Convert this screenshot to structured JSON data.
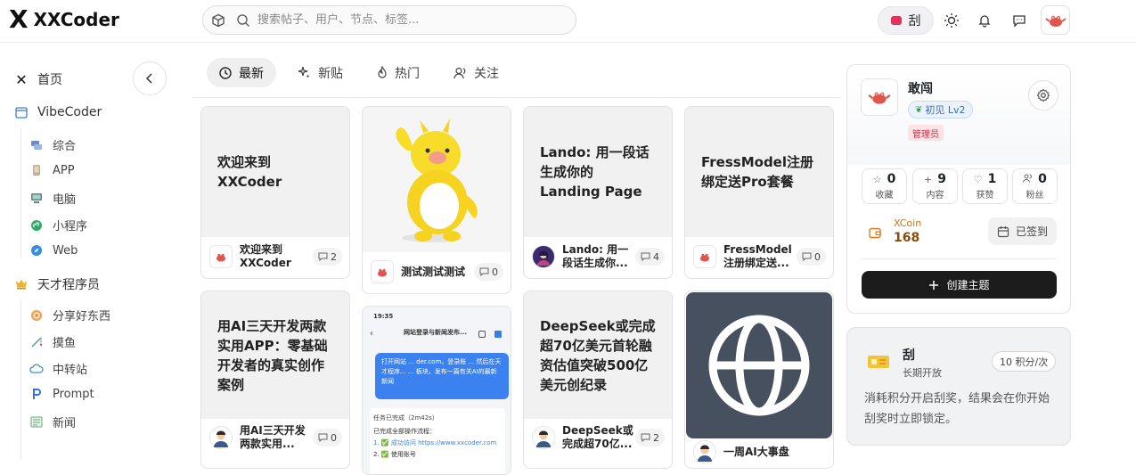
{
  "brand": {
    "logo_mark": "X",
    "name": "XXCoder"
  },
  "search": {
    "placeholder": "搜索帖子、用户、节点、标签..."
  },
  "topbar": {
    "scratch_label": "刮"
  },
  "sidebar": {
    "home": "首页",
    "vibecoder": "VibeCoder",
    "vibe_items": [
      "综合",
      "APP",
      "电脑",
      "小程序",
      "Web"
    ],
    "genius": "天才程序员",
    "genius_items": [
      "分享好东西",
      "摸鱼",
      "中转站",
      "Prompt",
      "新闻"
    ]
  },
  "tabs": [
    "最新",
    "新贴",
    "热门",
    "关注"
  ],
  "cards": [
    {
      "cover_title": "欢迎来到XXCoder",
      "title": "欢迎来到XXCoder",
      "count": "2"
    },
    {
      "cover_title": "",
      "title": "测试测试测试",
      "count": "0"
    },
    {
      "cover_title": "Lando: 用一段话生成你的 Landing Page",
      "title": "Lando: 用一段话生成你...",
      "count": "4"
    },
    {
      "cover_title": "FressModel注册绑定送Pro套餐",
      "title": "FressModel注册绑定送...",
      "count": "0"
    },
    {
      "cover_title": "用AI三天开发两款实用APP：零基础开发者的真实创作案例",
      "title": "用AI三天开发两款实用...",
      "count": "0"
    },
    {
      "cover_title": "",
      "title": "",
      "count": ""
    },
    {
      "cover_title": "DeepSeek或完成超70亿美元首轮融资估值突破500亿美元创纪录",
      "title": "DeepSeek或完成超70亿...",
      "count": "2"
    },
    {
      "cover_title": "",
      "title": "一周AI大事盘",
      "count": ""
    }
  ],
  "phone_shot": {
    "time": "19:35",
    "header": "网站登录与新闻发布...",
    "bubble": "打开网站 ... der.com，登录账 ... 然后在天才程序... ... 板块，发布一篇有关AI的最新新闻",
    "task": "任务已完成（2m42s）",
    "done": "已完成全部操作流程：",
    "step1": "1. ✅ 成功访问 https://www.xxcoder.com",
    "step2": "2. ✅ 使用账号"
  },
  "profile": {
    "name": "敢闯",
    "level": "初见 Lv2",
    "role": "管理员",
    "stats": [
      {
        "value": "0",
        "label": "收藏",
        "icon": "star-icon"
      },
      {
        "value": "9",
        "label": "内容",
        "icon": "plus-icon"
      },
      {
        "value": "1",
        "label": "获赞",
        "icon": "heart-icon"
      },
      {
        "value": "0",
        "label": "粉丝",
        "icon": "users-icon"
      }
    ],
    "xcoin_label": "XCoin",
    "xcoin_value": "168",
    "signed": "已签到",
    "create": "创建主题"
  },
  "scratch": {
    "title": "刮",
    "subtitle": "长期开放",
    "cost": "10 积分/次",
    "desc": "消耗积分开启刮奖，结果会在你开始刮奖时立即锁定。"
  },
  "colors": {
    "accent": "#1c1c1c",
    "badge_red": "#e0325a",
    "coin": "#e07a18"
  }
}
